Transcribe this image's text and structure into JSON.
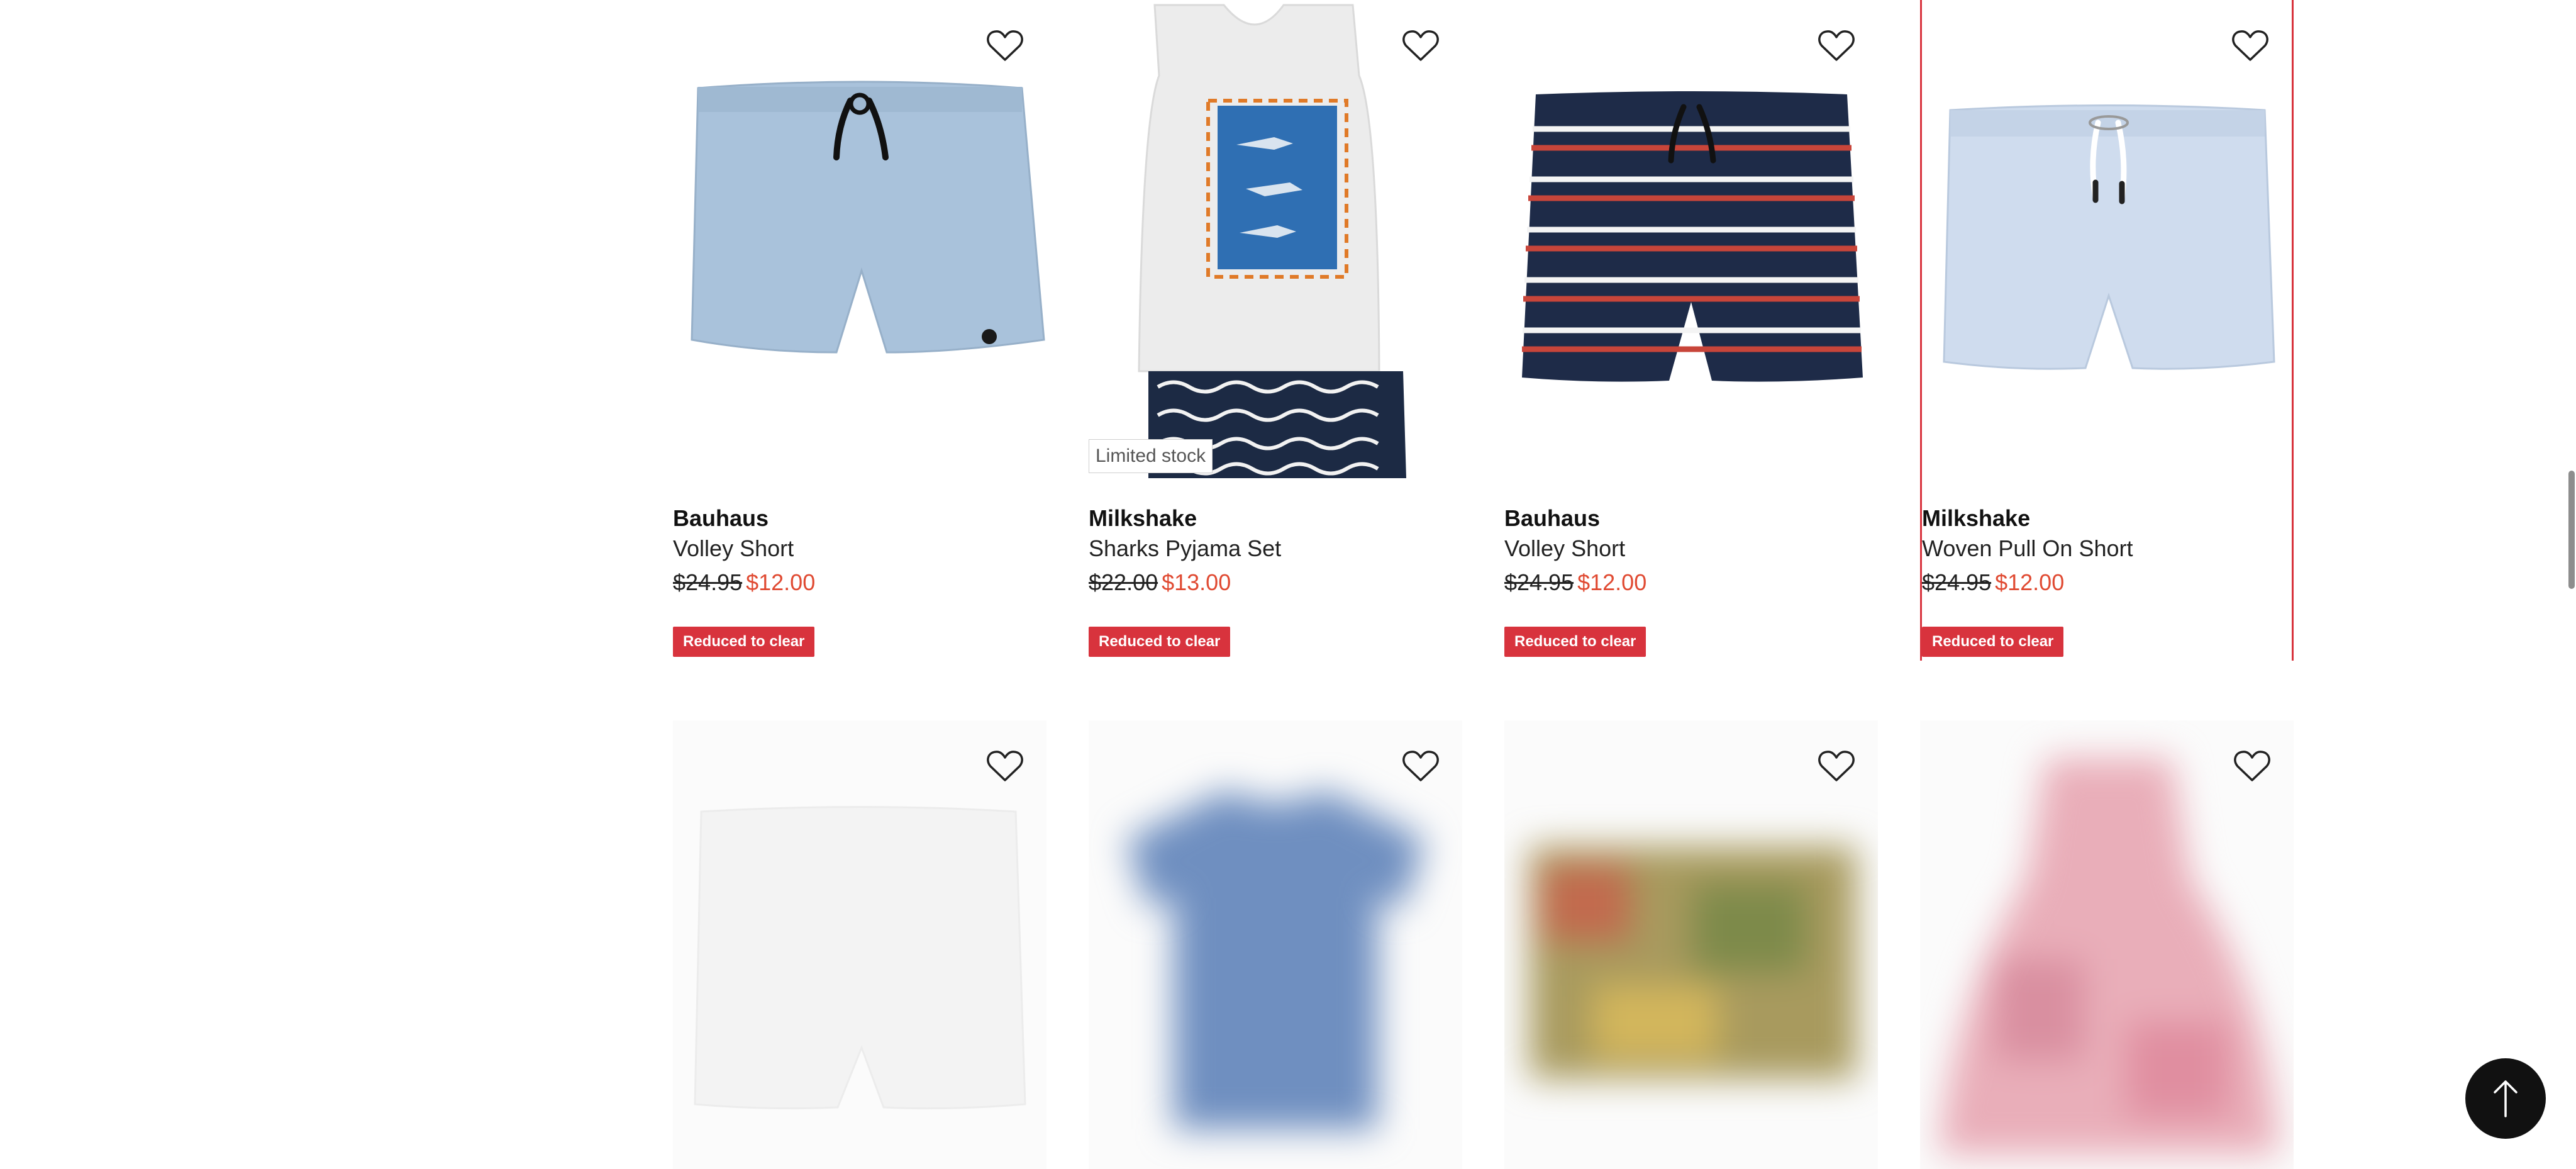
{
  "colors": {
    "sale_price": "#e04a32",
    "badge_bg": "#d8333d",
    "selected_outline": "#d8333d",
    "back_to_top_bg": "#111111"
  },
  "products": [
    {
      "brand": "Bauhaus",
      "name": "Volley Short",
      "was_price": "$24.95",
      "now_price": "$12.00",
      "badge": "Reduced to clear"
    },
    {
      "brand": "Milkshake",
      "name": "Sharks Pyjama Set",
      "was_price": "$22.00",
      "now_price": "$13.00",
      "badge": "Reduced to clear",
      "stock_label": "Limited stock"
    },
    {
      "brand": "Bauhaus",
      "name": "Volley Short",
      "was_price": "$24.95",
      "now_price": "$12.00",
      "badge": "Reduced to clear"
    },
    {
      "brand": "Milkshake",
      "name": "Woven Pull On Short",
      "was_price": "$24.95",
      "now_price": "$12.00",
      "badge": "Reduced to clear"
    }
  ],
  "icons": {
    "wishlist": "heart-outline-icon",
    "back_to_top": "arrow-up-icon"
  }
}
